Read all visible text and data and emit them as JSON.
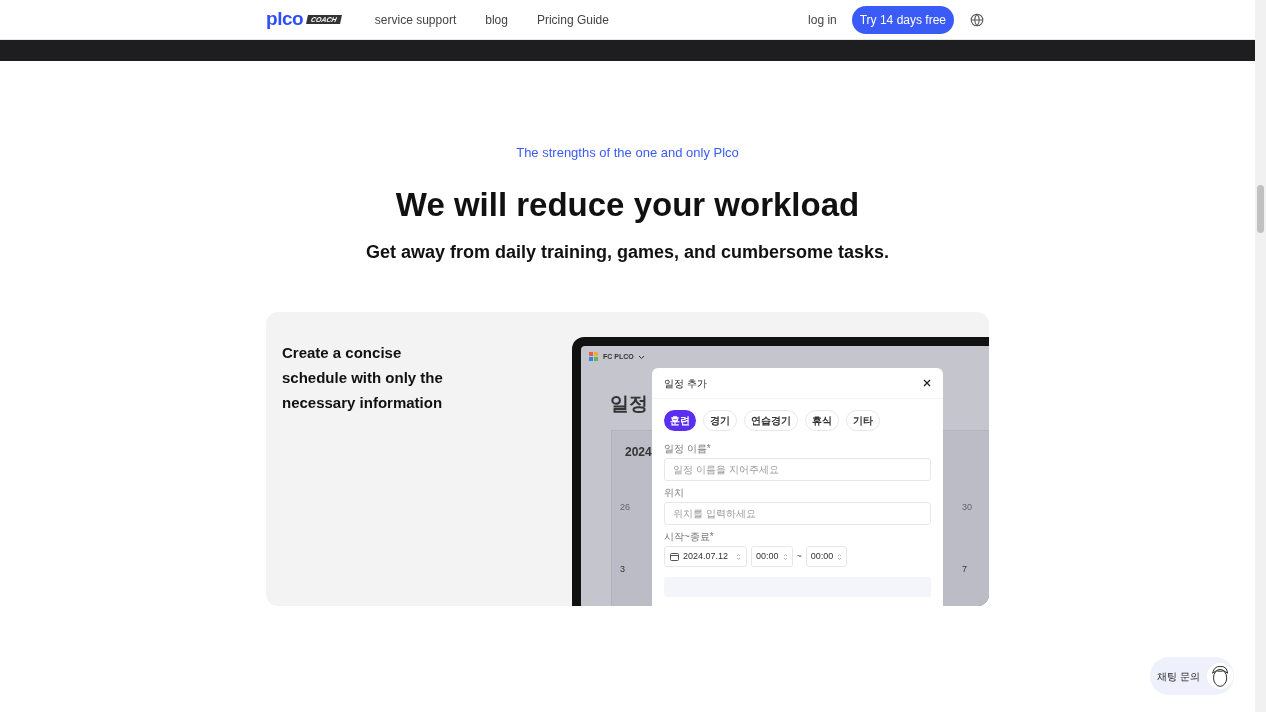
{
  "header": {
    "logo": "plco",
    "logo_badge": "COACH",
    "nav": [
      "service support",
      "blog",
      "Pricing Guide"
    ],
    "login": "log in",
    "cta": "Try 14 days free"
  },
  "hero": {
    "eyebrow": "The strengths of the one and only Plco",
    "title": "We will reduce your workload",
    "subtitle": "Get away from daily training, games, and cumbersome tasks."
  },
  "feature": {
    "heading": "Create a concise schedule with only the necessary information",
    "mockup": {
      "team": "FC PLCO",
      "page_title": "일정",
      "year": "2024",
      "dates": [
        "26",
        "30",
        "3",
        "7"
      ],
      "modal": {
        "title": "일정 추가",
        "categories": [
          {
            "label": "훈련",
            "selected": true
          },
          {
            "label": "경기",
            "selected": false
          },
          {
            "label": "연습경기",
            "selected": false
          },
          {
            "label": "휴식",
            "selected": false
          },
          {
            "label": "기타",
            "selected": false
          }
        ],
        "fields": [
          {
            "label": "일정 이름*",
            "placeholder": "일정 이름을 지어주세요"
          },
          {
            "label": "위치",
            "placeholder": "위치를 입력하세요"
          }
        ],
        "time_label": "시작~종료*",
        "date": "2024.07.12",
        "start": "00:00",
        "separator": "~",
        "end": "00:00"
      }
    }
  },
  "chat": {
    "label": "채팅 문의"
  }
}
